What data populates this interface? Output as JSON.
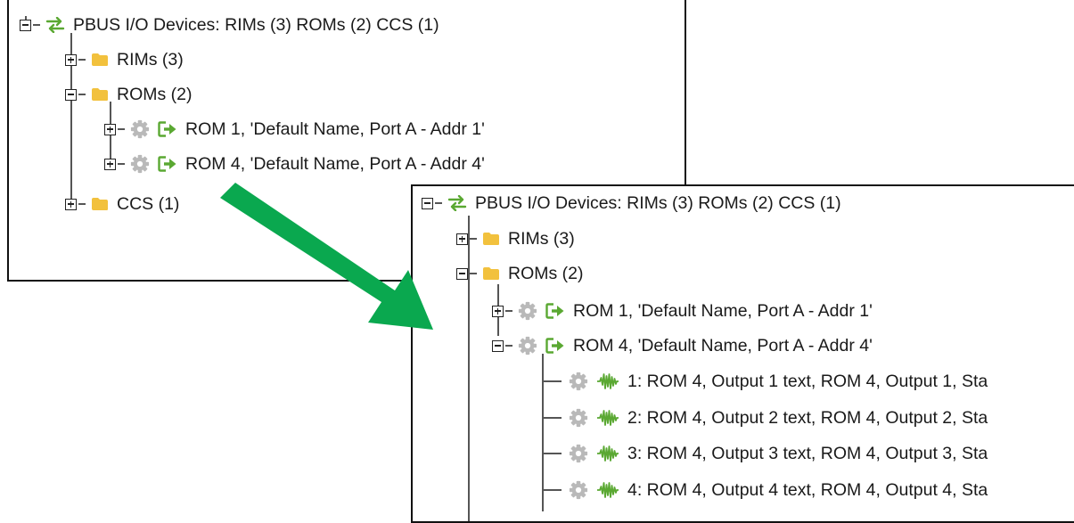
{
  "tree_collapsed": {
    "root_label": "PBUS I/O Devices: RIMs (3) ROMs (2) CCS (1)",
    "rims_label": "RIMs (3)",
    "roms_label": "ROMs (2)",
    "rom1_label": "ROM 1, 'Default Name, Port A - Addr 1'",
    "rom4_label": "ROM 4, 'Default Name, Port A - Addr 4'",
    "ccs_label": "CCS (1)"
  },
  "tree_expanded": {
    "root_label": "PBUS I/O Devices: RIMs (3) ROMs (2) CCS (1)",
    "rims_label": "RIMs (3)",
    "roms_label": "ROMs (2)",
    "rom1_label": "ROM 1, 'Default Name, Port A - Addr 1'",
    "rom4_label": "ROM 4, 'Default Name, Port A - Addr 4'",
    "outputs": [
      "1: ROM 4, Output 1 text, ROM 4, Output 1, Sta",
      "2: ROM 4, Output 2 text, ROM 4, Output 2, Sta",
      "3: ROM 4, Output 3 text, ROM 4, Output 3, Sta",
      "4: ROM 4, Output 4 text, ROM 4, Output 4, Sta"
    ]
  },
  "icons": {
    "root": "bidirectional-arrows-icon",
    "folder": "folder-icon",
    "device": "gear-icon",
    "rom": "output-arrow-icon",
    "output": "waveform-icon"
  },
  "colors": {
    "green": "#5aa832",
    "folder": "#f2c13d",
    "gear": "#b9b9b9",
    "callout_arrow": "#0aa84f"
  }
}
